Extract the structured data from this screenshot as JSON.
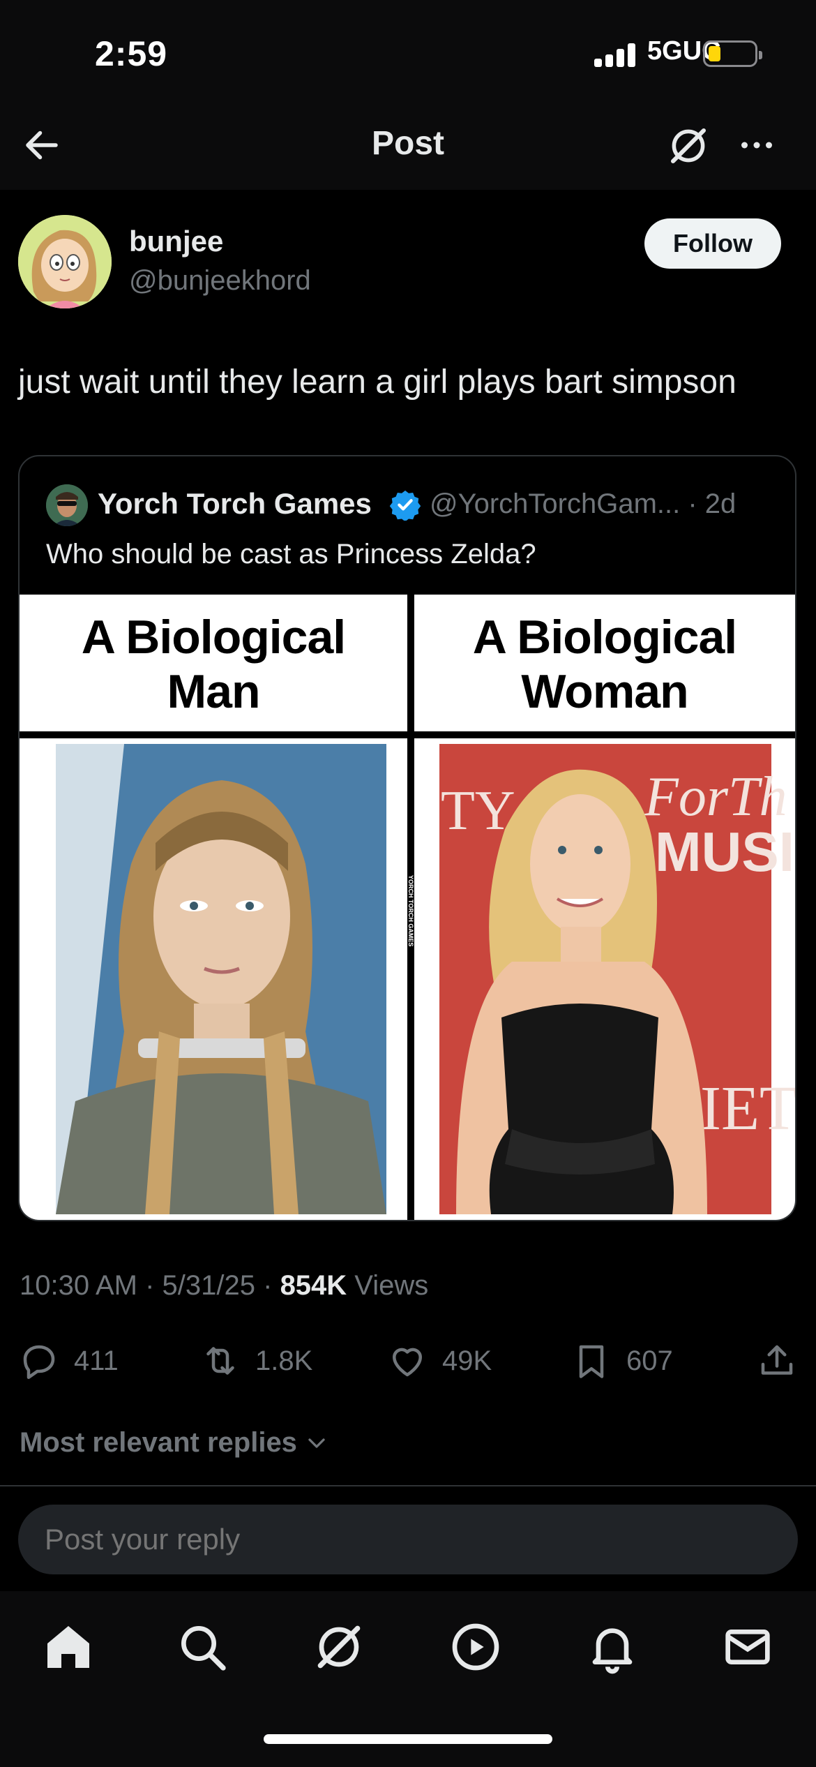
{
  "status_bar": {
    "time": "2:59",
    "network": "5GUC"
  },
  "header": {
    "title": "Post"
  },
  "author": {
    "name": "bunjee",
    "handle": "@bunjeekhord",
    "follow_label": "Follow"
  },
  "post": {
    "text": "just wait until they learn a girl plays bart simpson"
  },
  "quoted": {
    "name": "Yorch Torch Games",
    "handle_and_time": "@YorchTorchGam... · 2d",
    "text": "Who should be cast as Princess Zelda?",
    "left_caption_line1": "A Biological",
    "left_caption_line2": "Man",
    "right_caption_line1": "A Biological",
    "right_caption_line2": "Woman",
    "watermark": "YORCH TORCH GAMES",
    "bg_sign_text_left": "TY",
    "bg_sign_text_right1": "ForTh",
    "bg_sign_text_right2": "MUSI",
    "bg_sign_text_right3": "RIET"
  },
  "meta": {
    "time_date": "10:30 AM · 5/31/25 · ",
    "views_count": "854K",
    "views_label": " Views"
  },
  "actions": {
    "replies": "411",
    "reposts": "1.8K",
    "likes": "49K",
    "bookmarks": "607"
  },
  "replies_sort": {
    "label": "Most relevant replies"
  },
  "reply_box": {
    "placeholder": "Post your reply"
  },
  "colors": {
    "background": "#000000",
    "verified": "#1d9bf0",
    "muted": "#71767b",
    "battery": "#ffd60a"
  }
}
